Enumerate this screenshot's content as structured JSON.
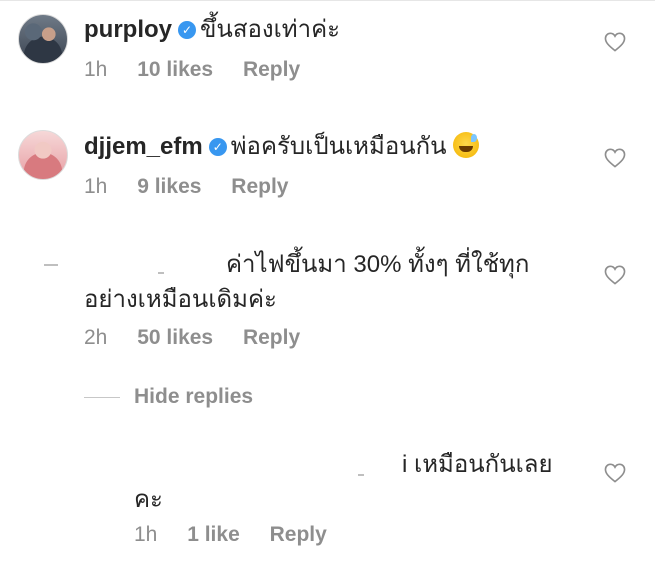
{
  "comments": [
    {
      "username": "purploy",
      "verified": true,
      "text": "ขึ้นสองเท่าค่ะ",
      "time": "1h",
      "likes": "10 likes",
      "reply": "Reply"
    },
    {
      "username": "djjem_efm",
      "verified": true,
      "text": "พ่อครับเป็นเหมือนกัน",
      "emoji": "sweat-smile",
      "time": "1h",
      "likes": "9 likes",
      "reply": "Reply"
    },
    {
      "text_line1": "ค่าไฟขึ้นมา 30% ทั้งๆ ที่ใช้ทุก",
      "text_line2": "อย่างเหมือนเดิมค่ะ",
      "time": "2h",
      "likes": "50 likes",
      "reply": "Reply"
    },
    {
      "text_line1": "i เหมือนกันเลย",
      "text_line2": "คะ",
      "time": "1h",
      "likes": "1 like",
      "reply": "Reply"
    }
  ],
  "hide_replies": "Hide replies",
  "icons": {
    "like": "heart-icon",
    "verified": "verified-badge-icon"
  },
  "colors": {
    "verified": "#3897f0",
    "meta": "#8e8e8e",
    "text": "#262626"
  }
}
